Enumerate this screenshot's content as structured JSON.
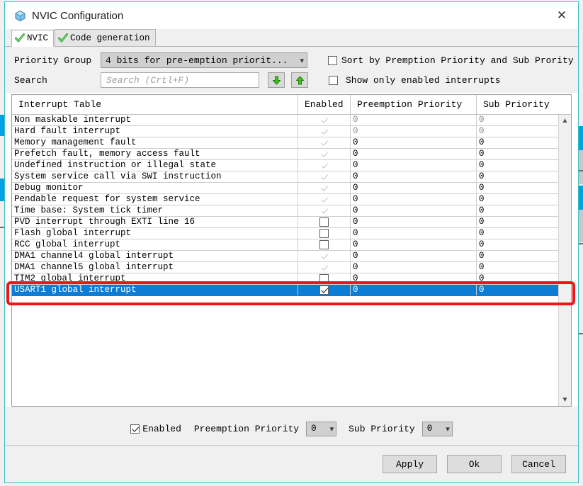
{
  "window": {
    "title": "NVIC Configuration",
    "icon": "cube-icon",
    "close_label": "✕"
  },
  "tabs": [
    {
      "label": "NVIC",
      "icon": "green-check-icon",
      "active": true
    },
    {
      "label": "Code generation",
      "icon": "green-check-icon",
      "active": false
    }
  ],
  "toolbar": {
    "priority_group_label": "Priority Group",
    "priority_group_value": "4 bits for pre-emption priorit...",
    "sort_checkbox_label": "Sort by Premption Priority and Sub Prority",
    "sort_checkbox_checked": false,
    "search_label": "Search",
    "search_placeholder": "Search (Crtl+F)",
    "search_value": "",
    "find_next_icon": "arrow-down-icon",
    "find_prev_icon": "arrow-up-icon",
    "show_enabled_label": "Show only enabled interrupts",
    "show_enabled_checked": false
  },
  "table": {
    "columns": [
      "Interrupt Table",
      "Enabled",
      "Preemption Priority",
      "Sub Priority"
    ],
    "rows": [
      {
        "name": "Non maskable interrupt",
        "enabled": true,
        "locked": true,
        "preemption": "0",
        "sub": "0",
        "dim": true,
        "selected": false
      },
      {
        "name": "Hard fault interrupt",
        "enabled": true,
        "locked": true,
        "preemption": "0",
        "sub": "0",
        "dim": true,
        "selected": false
      },
      {
        "name": "Memory management fault",
        "enabled": true,
        "locked": true,
        "preemption": "0",
        "sub": "0",
        "dim": false,
        "selected": false
      },
      {
        "name": "Prefetch fault, memory access fault",
        "enabled": true,
        "locked": true,
        "preemption": "0",
        "sub": "0",
        "dim": false,
        "selected": false
      },
      {
        "name": "Undefined instruction or illegal state",
        "enabled": true,
        "locked": true,
        "preemption": "0",
        "sub": "0",
        "dim": false,
        "selected": false
      },
      {
        "name": "System service call via SWI instruction",
        "enabled": true,
        "locked": true,
        "preemption": "0",
        "sub": "0",
        "dim": false,
        "selected": false
      },
      {
        "name": "Debug monitor",
        "enabled": true,
        "locked": true,
        "preemption": "0",
        "sub": "0",
        "dim": false,
        "selected": false
      },
      {
        "name": "Pendable request for system service",
        "enabled": true,
        "locked": true,
        "preemption": "0",
        "sub": "0",
        "dim": false,
        "selected": false
      },
      {
        "name": "Time base: System tick timer",
        "enabled": true,
        "locked": true,
        "preemption": "0",
        "sub": "0",
        "dim": false,
        "selected": false
      },
      {
        "name": "PVD interrupt through EXTI line 16",
        "enabled": false,
        "locked": false,
        "preemption": "0",
        "sub": "0",
        "dim": false,
        "selected": false
      },
      {
        "name": "Flash global interrupt",
        "enabled": false,
        "locked": false,
        "preemption": "0",
        "sub": "0",
        "dim": false,
        "selected": false
      },
      {
        "name": "RCC global interrupt",
        "enabled": false,
        "locked": false,
        "preemption": "0",
        "sub": "0",
        "dim": false,
        "selected": false
      },
      {
        "name": "DMA1 channel4 global interrupt",
        "enabled": true,
        "locked": true,
        "preemption": "0",
        "sub": "0",
        "dim": false,
        "selected": false
      },
      {
        "name": "DMA1 channel5 global interrupt",
        "enabled": true,
        "locked": true,
        "preemption": "0",
        "sub": "0",
        "dim": false,
        "selected": false
      },
      {
        "name": "TIM2 global interrupt",
        "enabled": false,
        "locked": false,
        "preemption": "0",
        "sub": "0",
        "dim": false,
        "selected": false
      },
      {
        "name": "USART1 global interrupt",
        "enabled": true,
        "locked": false,
        "preemption": "0",
        "sub": "0",
        "dim": false,
        "selected": true
      }
    ],
    "scroll_up_icon": "chevron-up-icon",
    "scroll_down_icon": "chevron-down-icon"
  },
  "editor": {
    "enabled_label": "Enabled",
    "enabled_checked": true,
    "preemption_label": "Preemption Priority",
    "preemption_value": "0",
    "sub_label": "Sub Priority",
    "sub_value": "0"
  },
  "buttons": {
    "apply": "Apply",
    "ok": "Ok",
    "cancel": "Cancel"
  },
  "colors": {
    "selection_blue": "#0c7cd5",
    "annotation_red": "#f01414",
    "window_border": "#3bbccb",
    "panel_gray": "#f0f0f0"
  }
}
